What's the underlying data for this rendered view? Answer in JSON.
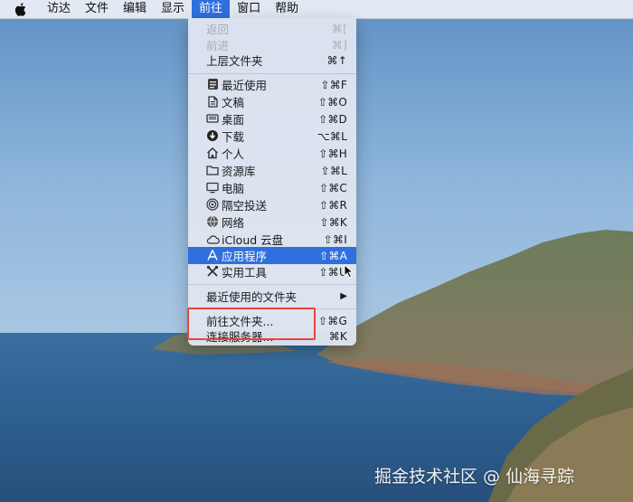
{
  "menubar": {
    "items": [
      {
        "label": "访达"
      },
      {
        "label": "文件"
      },
      {
        "label": "编辑"
      },
      {
        "label": "显示"
      },
      {
        "label": "前往"
      },
      {
        "label": "窗口"
      },
      {
        "label": "帮助"
      }
    ],
    "active": "前往"
  },
  "go_menu": {
    "items": [
      {
        "label": "返回",
        "shortcut": "⌘[",
        "disabled": true
      },
      {
        "label": "前进",
        "shortcut": "⌘]",
        "disabled": true
      },
      {
        "label": "上层文件夹",
        "shortcut": "⌘↑"
      },
      {
        "label": "最近使用",
        "shortcut": "⇧⌘F",
        "icon": "recents-icon"
      },
      {
        "label": "文稿",
        "shortcut": "⇧⌘O",
        "icon": "documents-icon"
      },
      {
        "label": "桌面",
        "shortcut": "⇧⌘D",
        "icon": "desktop-icon"
      },
      {
        "label": "下载",
        "shortcut": "⌥⌘L",
        "icon": "downloads-icon"
      },
      {
        "label": "个人",
        "shortcut": "⇧⌘H",
        "icon": "home-icon"
      },
      {
        "label": "资源库",
        "shortcut": "⇧⌘L",
        "icon": "library-icon"
      },
      {
        "label": "电脑",
        "shortcut": "⇧⌘C",
        "icon": "computer-icon"
      },
      {
        "label": "隔空投送",
        "shortcut": "⇧⌘R",
        "icon": "airdrop-icon"
      },
      {
        "label": "网络",
        "shortcut": "⇧⌘K",
        "icon": "network-icon"
      },
      {
        "label": "iCloud 云盘",
        "shortcut": "⇧⌘I",
        "icon": "icloud-icon"
      },
      {
        "label": "应用程序",
        "shortcut": "⇧⌘A",
        "icon": "applications-icon",
        "highlighted": true
      },
      {
        "label": "实用工具",
        "shortcut": "⇧⌘U",
        "icon": "utilities-icon"
      },
      {
        "label": "最近使用的文件夹",
        "submenu": true
      },
      {
        "label": "前往文件夹...",
        "shortcut": "⇧⌘G"
      },
      {
        "label": "连接服务器...",
        "shortcut": "⌘K"
      }
    ]
  },
  "watermark": "掘金技术社区 @ 仙海寻踪",
  "colors": {
    "highlight": "#2f6fde",
    "annotation": "#e8453b"
  }
}
